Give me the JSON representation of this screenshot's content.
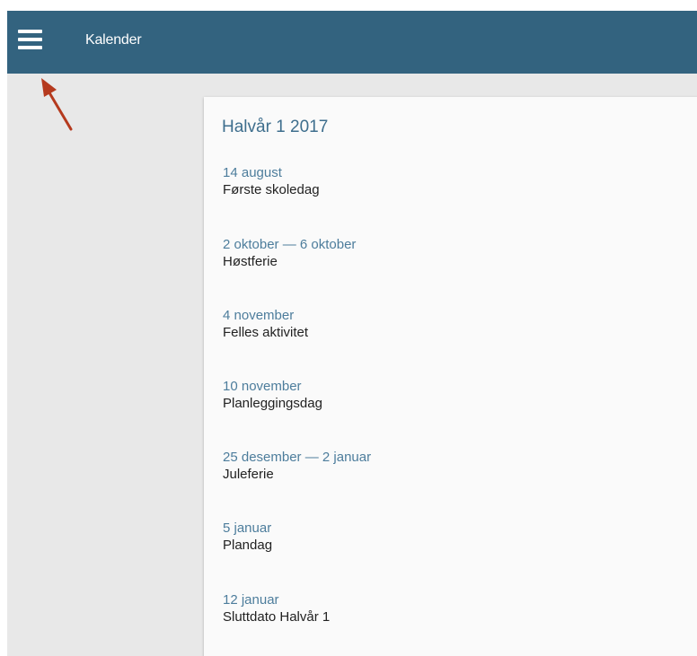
{
  "header": {
    "title": "Kalender",
    "menu_icon": "hamburger-menu-icon",
    "color": "#33637f"
  },
  "annotation": {
    "icon": "arrow-up-left-icon",
    "color": "#b53a1e"
  },
  "calendar": {
    "title": "Halvår 1 2017",
    "events": [
      {
        "date": "14 august",
        "name": "Første skoledag"
      },
      {
        "date": "2 oktober — 6 oktober",
        "name": "Høstferie"
      },
      {
        "date": "4 november",
        "name": "Felles aktivitet"
      },
      {
        "date": "10 november",
        "name": "Planleggingsdag"
      },
      {
        "date": "25 desember — 2 januar",
        "name": "Juleferie"
      },
      {
        "date": "5 januar",
        "name": "Plandag"
      },
      {
        "date": "12 januar",
        "name": "Sluttdato Halvår 1"
      }
    ]
  }
}
